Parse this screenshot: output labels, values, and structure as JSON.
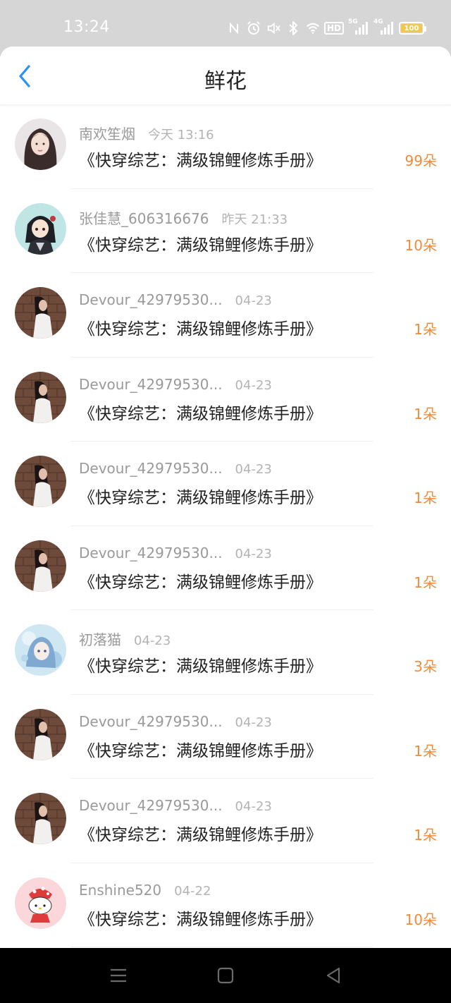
{
  "status_bar": {
    "time": "13:24",
    "icons": [
      "nfc-icon",
      "alarm-icon",
      "mute-icon",
      "bluetooth-icon",
      "wifi-icon",
      "hd-icon",
      "signal-5g-icon",
      "signal-4g-icon"
    ],
    "hd_label": "HD",
    "signal1_label": "5G",
    "signal2_label": "4G",
    "battery": "100"
  },
  "header": {
    "title": "鲜花",
    "accent_color": "#2a8ff7"
  },
  "list": {
    "items": [
      {
        "username": "南欢笙烟",
        "time": "今天 13:16",
        "book": "《快穿综艺：满级锦鲤修炼手册》",
        "flowers": "99朵",
        "avatar": "avatar-girl-long-hair"
      },
      {
        "username": "张佳慧_606316676",
        "time": "昨天 21:33",
        "book": "《快穿综艺：满级锦鲤修炼手册》",
        "flowers": "10朵",
        "avatar": "avatar-anime-character"
      },
      {
        "username": "Devour_42979530...",
        "time": "04-23",
        "book": "《快穿综艺：满级锦鲤修炼手册》",
        "flowers": "1朵",
        "avatar": "avatar-girl-brick-wall"
      },
      {
        "username": "Devour_42979530...",
        "time": "04-23",
        "book": "《快穿综艺：满级锦鲤修炼手册》",
        "flowers": "1朵",
        "avatar": "avatar-girl-brick-wall"
      },
      {
        "username": "Devour_42979530...",
        "time": "04-23",
        "book": "《快穿综艺：满级锦鲤修炼手册》",
        "flowers": "1朵",
        "avatar": "avatar-girl-brick-wall"
      },
      {
        "username": "Devour_42979530...",
        "time": "04-23",
        "book": "《快穿综艺：满级锦鲤修炼手册》",
        "flowers": "1朵",
        "avatar": "avatar-girl-brick-wall"
      },
      {
        "username": "初落猫",
        "time": "04-23",
        "book": "《快穿综艺：满级锦鲤修炼手册》",
        "flowers": "3朵",
        "avatar": "avatar-blue-anime-girl"
      },
      {
        "username": "Devour_42979530...",
        "time": "04-23",
        "book": "《快穿综艺：满级锦鲤修炼手册》",
        "flowers": "1朵",
        "avatar": "avatar-girl-brick-wall"
      },
      {
        "username": "Devour_42979530...",
        "time": "04-23",
        "book": "《快穿综艺：满级锦鲤修炼手册》",
        "flowers": "1朵",
        "avatar": "avatar-girl-brick-wall"
      },
      {
        "username": "Enshine520",
        "time": "04-22",
        "book": "《快穿综艺：满级锦鲤修炼手册》",
        "flowers": "10朵",
        "avatar": "avatar-hello-kitty"
      }
    ]
  },
  "colors": {
    "status_bar_bg": "#d6d6d6",
    "flower_count": "#f28a3a",
    "username": "#9a9a9a",
    "nav_bar_bg": "#000000"
  },
  "nav_bar": {
    "buttons": [
      "menu-icon",
      "home-icon",
      "back-triangle-icon"
    ]
  }
}
